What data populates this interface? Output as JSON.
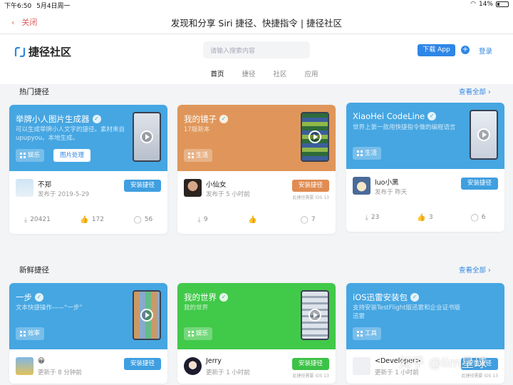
{
  "status": {
    "time": "下午6:50",
    "date": "5月4日周一",
    "battery": "14%"
  },
  "nav": {
    "close_label": "关闭",
    "title": "发现和分享 Siri 捷径、快捷指令 | 捷径社区"
  },
  "header": {
    "logo": "捷径社区",
    "search_placeholder": "请输入搜索内容",
    "download_label": "下载 App",
    "plus_label": "+",
    "login_label": "登录",
    "tabs": [
      "首页",
      "捷径",
      "社区",
      "应用"
    ]
  },
  "hot": {
    "title": "热门捷径",
    "see_all": "查看全部 ›",
    "cards": [
      {
        "title": "举牌小人图片生成器",
        "desc": "可以生成举牌小人文字的捷径。素材来自 upupyou。本地生成。",
        "tags": [
          "娱乐",
          "图片处理"
        ],
        "user": "不郑",
        "date": "发布于 2019-5-29",
        "install": "安装捷径",
        "req": "",
        "downloads": "20421",
        "likes": "172",
        "comments": "56"
      },
      {
        "title": "我的镜子",
        "desc": "17版新本",
        "tags": [
          "生活"
        ],
        "user": "小仙女",
        "date": "发布于 5 小时前",
        "install": "安装捷径",
        "req": "此捷径需要 iOS 13",
        "downloads": "9",
        "likes": "",
        "comments": "7"
      },
      {
        "title": "XiaoHei CodeLine",
        "desc": "世界上第一款用快捷指令做的编程语言",
        "tags": [
          "生活"
        ],
        "user": "luo小黑",
        "date": "发布于 昨天",
        "install": "安装捷径",
        "req": "",
        "downloads": "23",
        "likes": "3",
        "comments": "6"
      }
    ]
  },
  "fresh": {
    "title": "新鲜捷径",
    "see_all": "查看全部 ›",
    "cards": [
      {
        "title": "一步",
        "desc": "文本快捷操作——“一步”",
        "tags": [
          "效率"
        ],
        "user": "😀",
        "date": "更新于 8 分钟前",
        "install": "安装捷径",
        "req": ""
      },
      {
        "title": "我的世界",
        "desc": "我的世界",
        "tags": [
          "娱乐"
        ],
        "user": "Jerry",
        "date": "更新于 1 小时前",
        "install": "安装捷径",
        "req": "此捷径需要 iOS 13"
      },
      {
        "title": "iOS迅雷安装包",
        "desc": "支持安装TestFlight版迅雷和企业证书版迅雷",
        "tags": [
          "工具"
        ],
        "user": "<Developer>",
        "date": "更新于 1 小时前",
        "install": "安装捷径",
        "req": "此捷径需要 iOS 13"
      }
    ]
  },
  "watermark": "知乎 @lim星球",
  "colors": {
    "blue": "#45a6e2",
    "orange": "#e0965a",
    "green": "#41c94a",
    "accent": "#2f86e6",
    "install_blue": "#3f9fe0",
    "install_orange": "#e08c52",
    "install_green": "#3cc247"
  }
}
